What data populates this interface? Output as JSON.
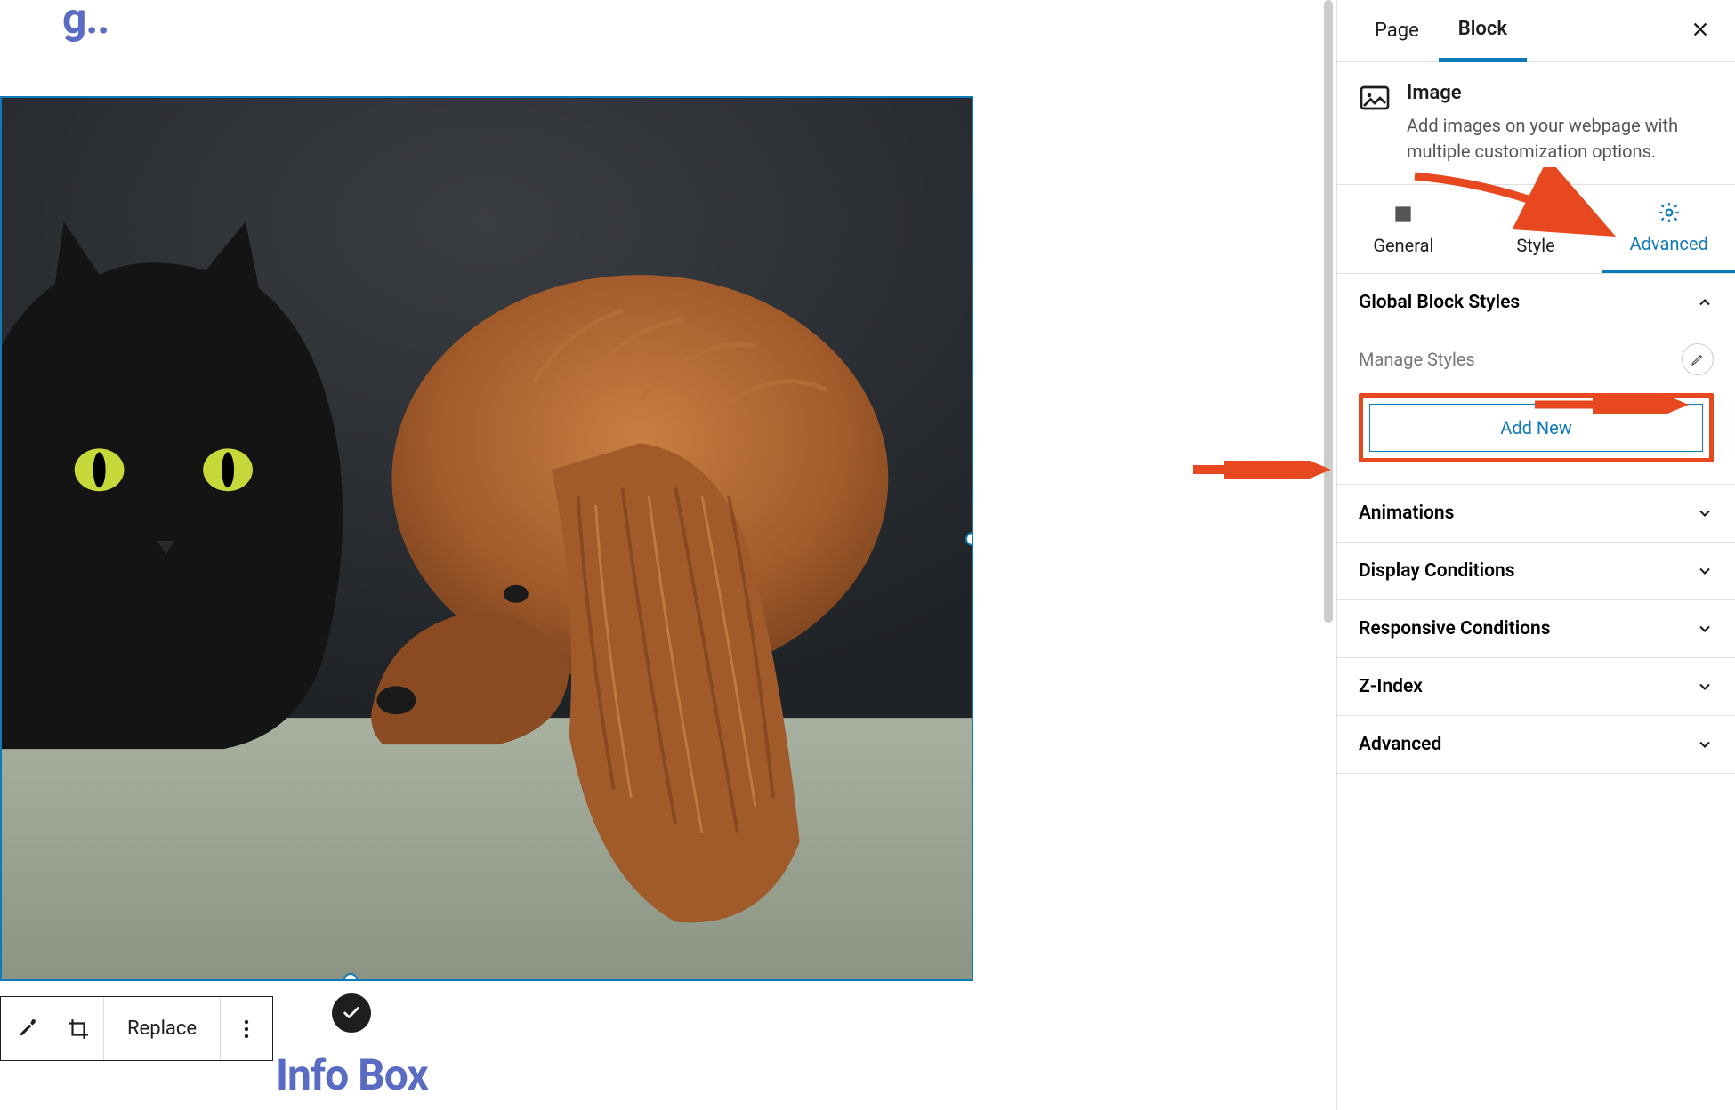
{
  "canvas": {
    "cropped_heading_fragment": "g..",
    "info_box_heading": "Info Box"
  },
  "toolbar": {
    "replace_label": "Replace"
  },
  "sidebar": {
    "tabs": {
      "page": "Page",
      "block": "Block"
    },
    "block_info": {
      "title": "Image",
      "description": "Add images on your webpage with multiple customization options."
    },
    "settings_tabs": {
      "general": "General",
      "style": "Style",
      "advanced": "Advanced"
    },
    "panels": {
      "global_block_styles": "Global Block Styles",
      "manage_styles": "Manage Styles",
      "add_new": "Add New",
      "animations": "Animations",
      "display_conditions": "Display Conditions",
      "responsive_conditions": "Responsive Conditions",
      "z_index": "Z-Index",
      "advanced": "Advanced"
    }
  },
  "annotation": {
    "arrow_color": "#e8481f",
    "highlight_color": "#e8481f"
  }
}
